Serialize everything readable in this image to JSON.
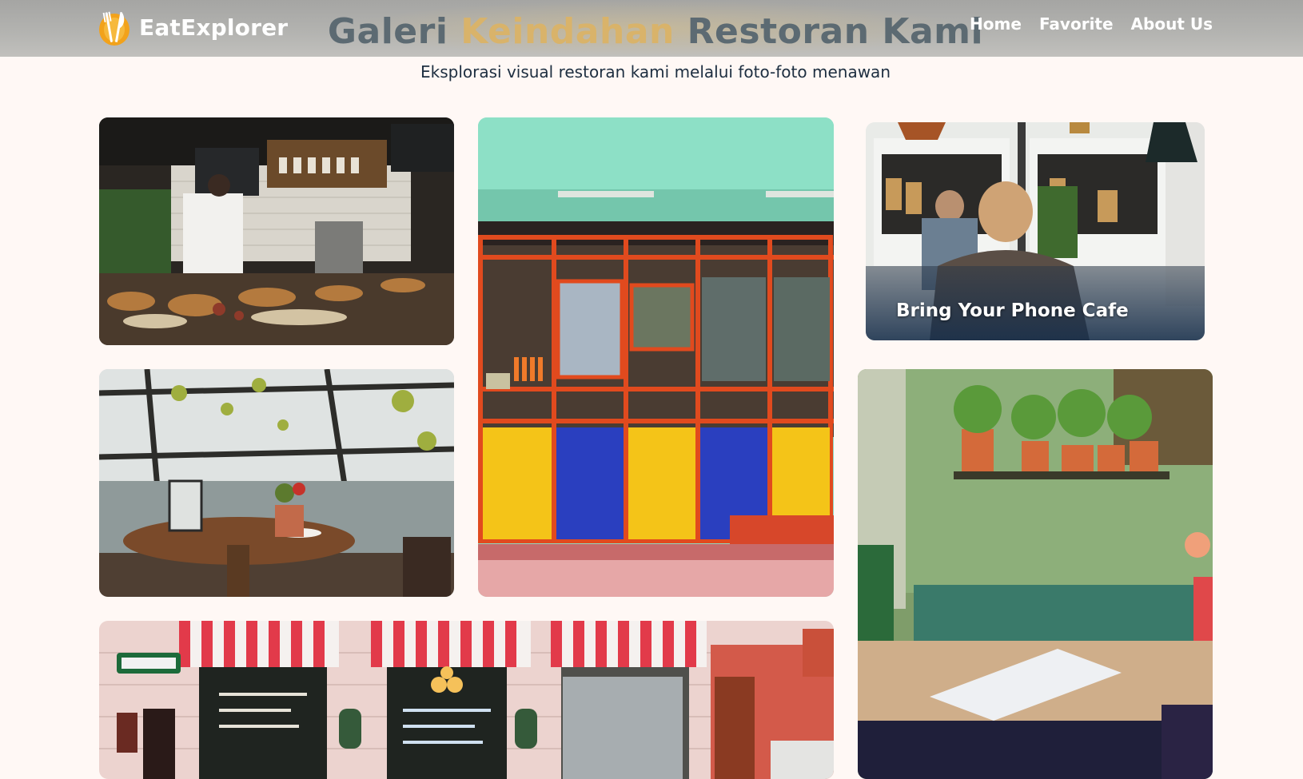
{
  "header": {
    "brand_name": "EatExplorer",
    "logo_icon": "fork-knife-logo-icon",
    "hero_title_part1": "Galeri ",
    "hero_title_accent": "Keindahan",
    "hero_title_part2": " Restoran Kami",
    "nav": [
      {
        "label": "Home"
      },
      {
        "label": "Favorite"
      },
      {
        "label": "About Us"
      }
    ]
  },
  "subtitle": "Eksplorasi visual restoran kami melalui foto-foto menawan",
  "gallery": {
    "tiles": [
      {
        "name": "cafe-counter-photo"
      },
      {
        "name": "colorful-storefront-photo"
      },
      {
        "name": "phone-cafe-photo",
        "caption": "Bring Your Phone Cafe"
      },
      {
        "name": "window-table-photo"
      },
      {
        "name": "garden-table-photo"
      },
      {
        "name": "bistro-street-photo"
      }
    ]
  },
  "colors": {
    "background": "#fff8f5",
    "header_bg": "#b4b4b1",
    "title_grey": "#5c6a72",
    "title_accent": "#d9b36a",
    "logo_orange": "#f2a21b"
  }
}
